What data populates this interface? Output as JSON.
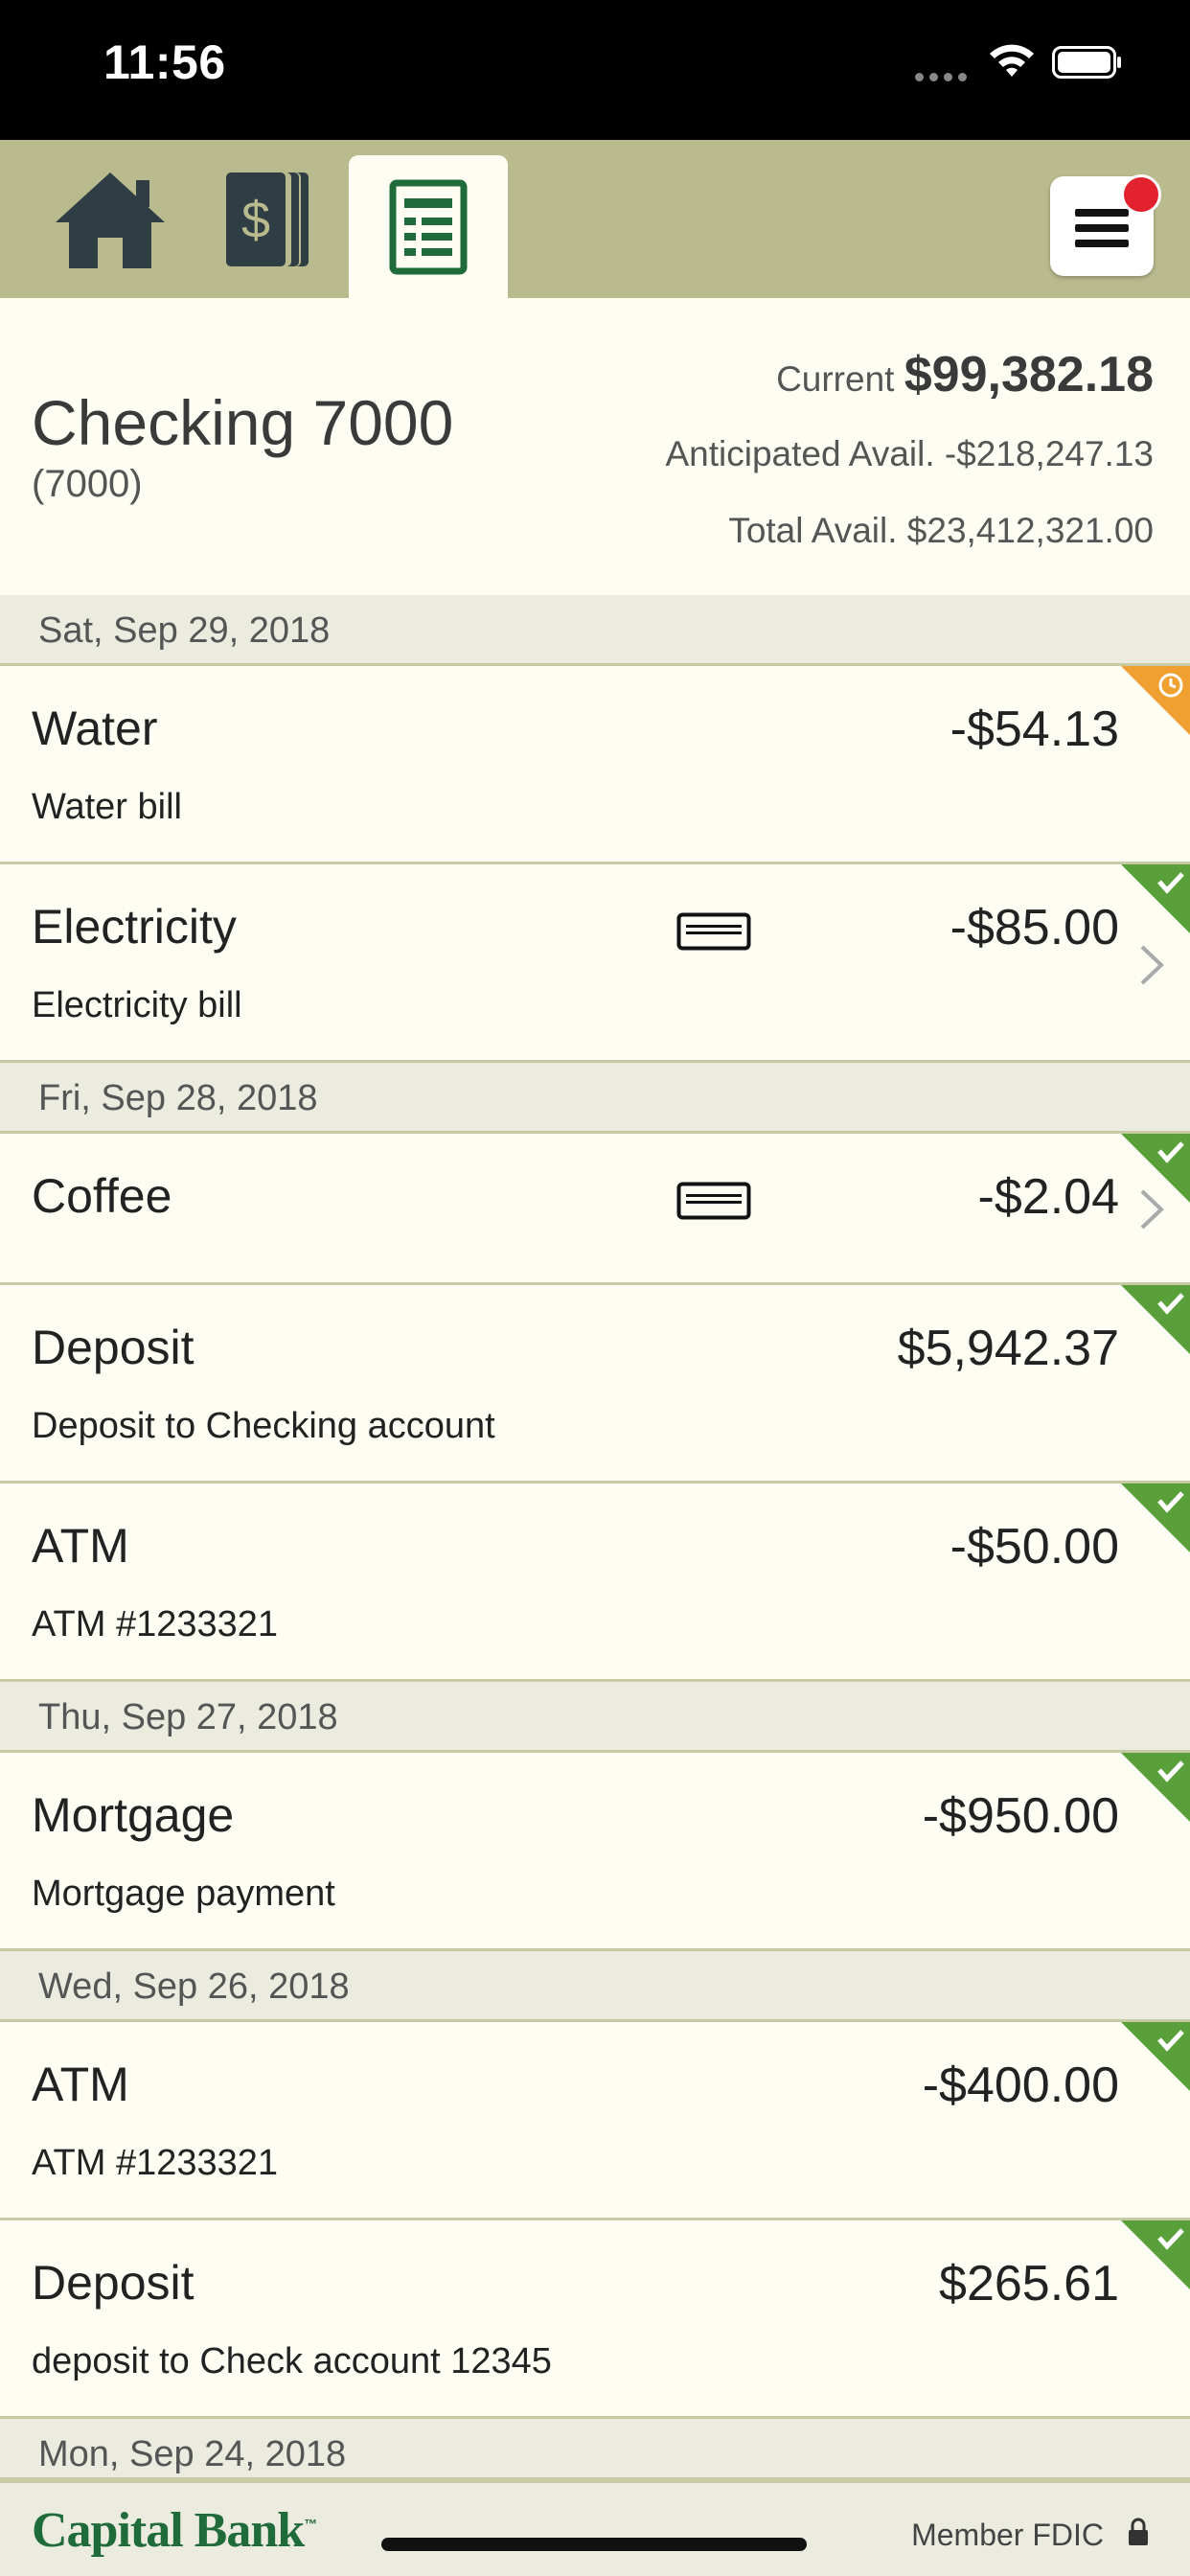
{
  "status_bar": {
    "time": "11:56"
  },
  "nav": {
    "tabs": [
      {
        "icon": "home-icon",
        "active": false
      },
      {
        "icon": "accounts-icon",
        "active": false
      },
      {
        "icon": "register-icon",
        "active": true
      }
    ],
    "menu_icon": "hamburger-menu-icon",
    "menu_has_notification": true
  },
  "account": {
    "name": "Checking 7000",
    "number": "(7000)",
    "current_label": "Current",
    "current_value": "$99,382.18",
    "anticipated_label": "Anticipated Avail.",
    "anticipated_value": "-$218,247.13",
    "total_label": "Total Avail.",
    "total_value": "$23,412,321.00"
  },
  "transactions": {
    "d1": "Sat, Sep 29, 2018",
    "t1": {
      "name": "Water",
      "desc": "Water bill",
      "amount": "-$54.13",
      "status": "pending"
    },
    "t2": {
      "name": "Electricity",
      "desc": "Electricity bill",
      "amount": "-$85.00",
      "status": "cleared"
    },
    "d2": "Fri, Sep 28, 2018",
    "t3": {
      "name": "Coffee",
      "desc": "",
      "amount": "-$2.04",
      "status": "cleared"
    },
    "t4": {
      "name": "Deposit",
      "desc": "Deposit to Checking account",
      "amount": "$5,942.37",
      "status": "cleared"
    },
    "t5": {
      "name": "ATM",
      "desc": "ATM #1233321",
      "amount": "-$50.00",
      "status": "cleared"
    },
    "d3": "Thu, Sep 27, 2018",
    "t6": {
      "name": "Mortgage",
      "desc": "Mortgage payment",
      "amount": "-$950.00",
      "status": "cleared"
    },
    "d4": "Wed, Sep 26, 2018",
    "t7": {
      "name": "ATM",
      "desc": "ATM #1233321",
      "amount": "-$400.00",
      "status": "cleared"
    },
    "t8": {
      "name": "Deposit",
      "desc": "deposit to Check account 12345",
      "amount": "$265.61",
      "status": "cleared"
    },
    "d5": "Mon, Sep 24, 2018"
  },
  "footer": {
    "bank_name": "Capital Bank",
    "trademark": "™",
    "fdic": "Member FDIC"
  },
  "colors": {
    "nav_bg": "#b9ba8d",
    "page_bg": "#fdfdf3",
    "cleared_green": "#5aa03a",
    "pending_orange": "#f0a030",
    "brand_green": "#1f6b3a",
    "badge_red": "#e2222e"
  }
}
